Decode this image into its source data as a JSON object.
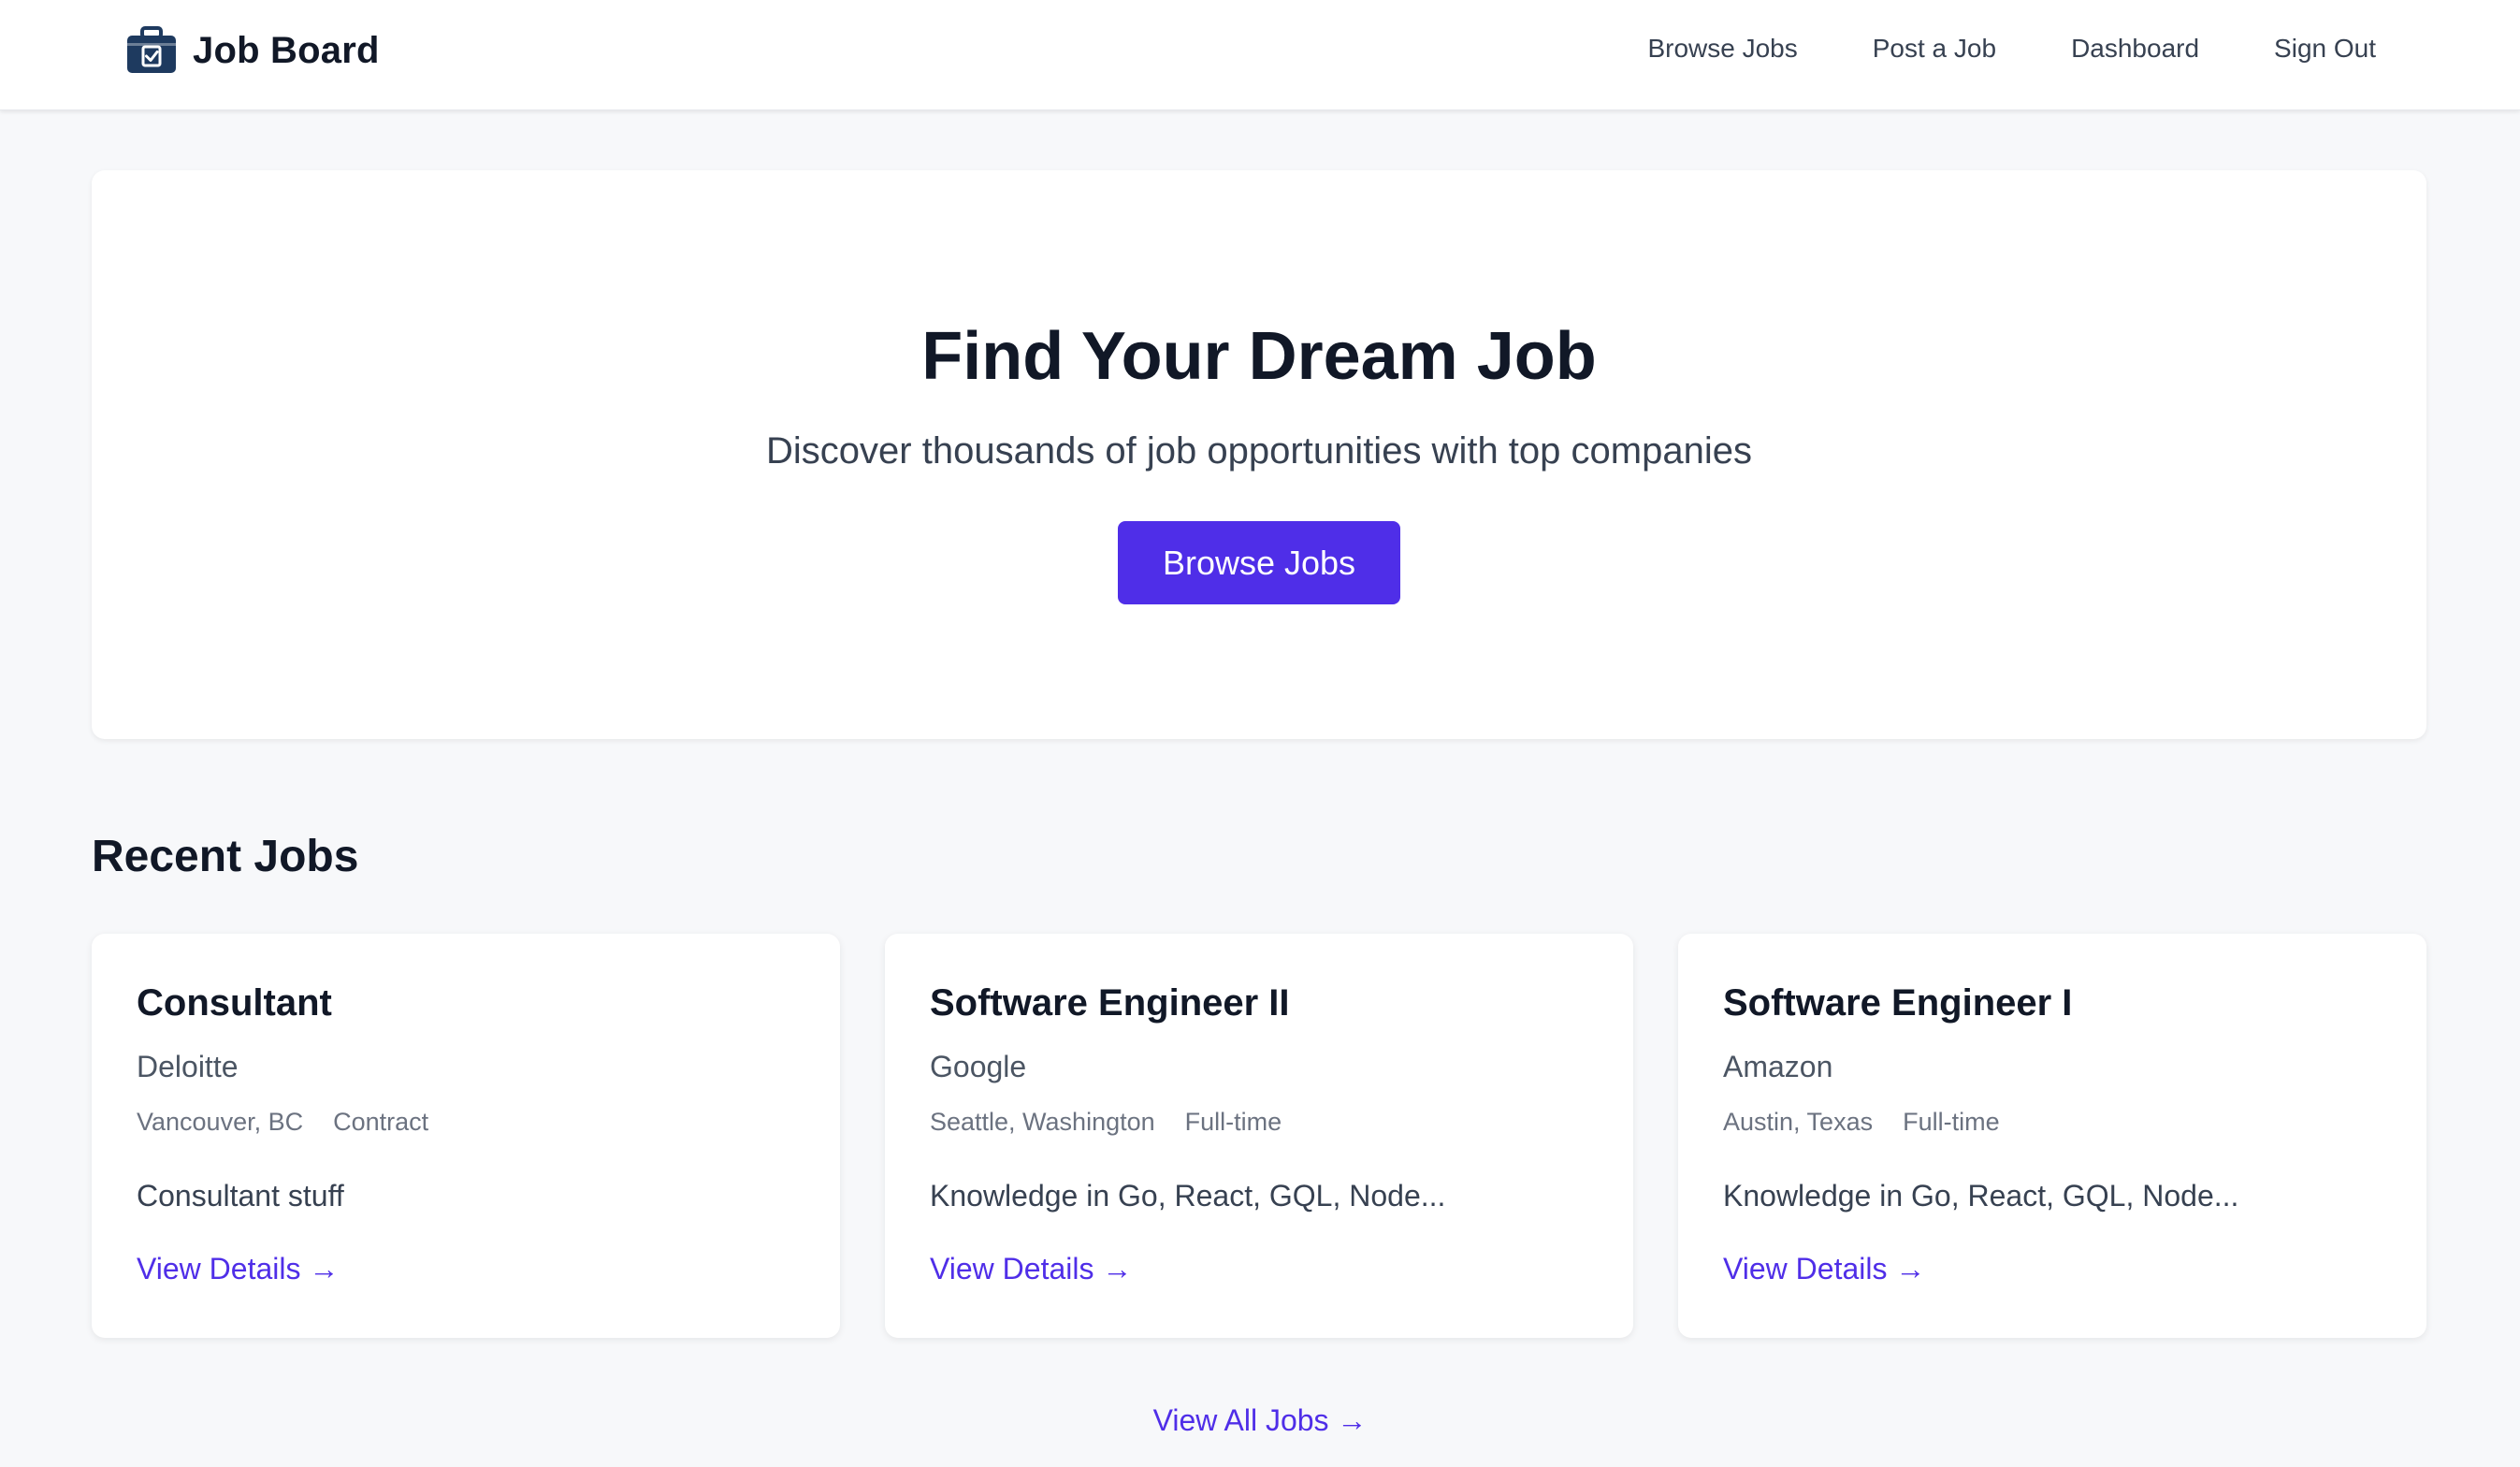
{
  "navbar": {
    "brand": "Job Board",
    "brand_icon": "briefcase-icon",
    "links": [
      "Browse Jobs",
      "Post a Job",
      "Dashboard",
      "Sign Out"
    ]
  },
  "hero": {
    "title": "Find Your Dream Job",
    "subtitle": "Discover thousands of job opportunities with top companies",
    "button": "Browse Jobs"
  },
  "recent": {
    "title": "Recent Jobs",
    "jobs": [
      {
        "title": "Consultant",
        "company": "Deloitte",
        "location": "Vancouver, BC",
        "type": "Contract",
        "description": "Consultant stuff",
        "link": "View Details →"
      },
      {
        "title": "Software Engineer II",
        "company": "Google",
        "location": "Seattle, Washington",
        "type": "Full-time",
        "description": "Knowledge in Go, React, GQL, Node...",
        "link": "View Details →"
      },
      {
        "title": "Software Engineer I",
        "company": "Amazon",
        "location": "Austin, Texas",
        "type": "Full-time",
        "description": "Knowledge in Go, React, GQL, Node...",
        "link": "View Details →"
      }
    ],
    "view_all": "View All Jobs →"
  },
  "colors": {
    "accent": "#4f2ee8",
    "brand_icon": "#1e3a5f",
    "page_bg": "#f7f8fa"
  }
}
